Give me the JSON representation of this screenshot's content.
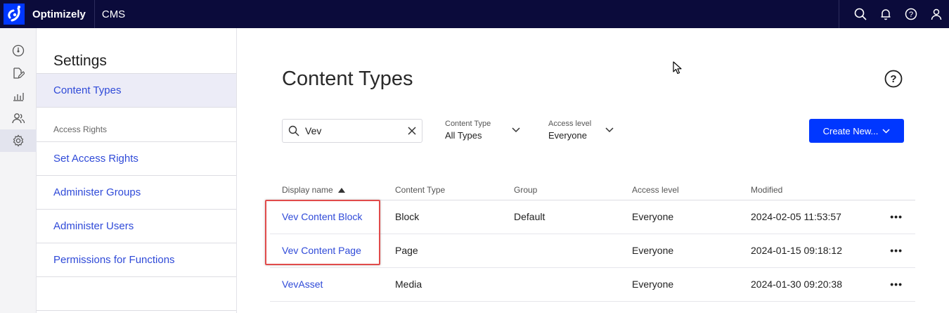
{
  "topbar": {
    "brand": "Optimizely",
    "product": "CMS",
    "icons": [
      "search-icon",
      "bell-icon",
      "help-icon",
      "user-icon"
    ],
    "color": "#0b0b3b"
  },
  "rail": {
    "icons": [
      "dashboard-icon",
      "edit-icon",
      "reports-icon",
      "users-icon",
      "settings-icon"
    ],
    "active": "settings-icon"
  },
  "settings": {
    "title": "Settings",
    "items": [
      {
        "label": "Content Types",
        "selected": true
      },
      {
        "section": "Access Rights"
      },
      {
        "label": "Set Access Rights"
      },
      {
        "label": "Administer Groups"
      },
      {
        "label": "Administer Users"
      },
      {
        "label": "Permissions for Functions"
      }
    ]
  },
  "main": {
    "title": "Content Types",
    "search": {
      "value": "Vev"
    },
    "filters": [
      {
        "label": "Content Type",
        "value": "All Types"
      },
      {
        "label": "Access level",
        "value": "Everyone"
      }
    ],
    "create_button": "Create New...",
    "accent": "#0037ff",
    "table": {
      "columns": [
        "Display name",
        "Content Type",
        "Group",
        "Access level",
        "Modified"
      ],
      "sort": {
        "column": "Display name",
        "direction": "ascending"
      },
      "rows": [
        {
          "name": "Vev Content Block",
          "type": "Block",
          "group": "Default",
          "access": "Everyone",
          "modified": "2024-02-05 11:53:57"
        },
        {
          "name": "Vev Content Page",
          "type": "Page",
          "group": "",
          "access": "Everyone",
          "modified": "2024-01-15 09:18:12"
        },
        {
          "name": "VevAsset",
          "type": "Media",
          "group": "",
          "access": "Everyone",
          "modified": "2024-01-30 09:20:38"
        }
      ]
    },
    "row_menu": "•••"
  }
}
